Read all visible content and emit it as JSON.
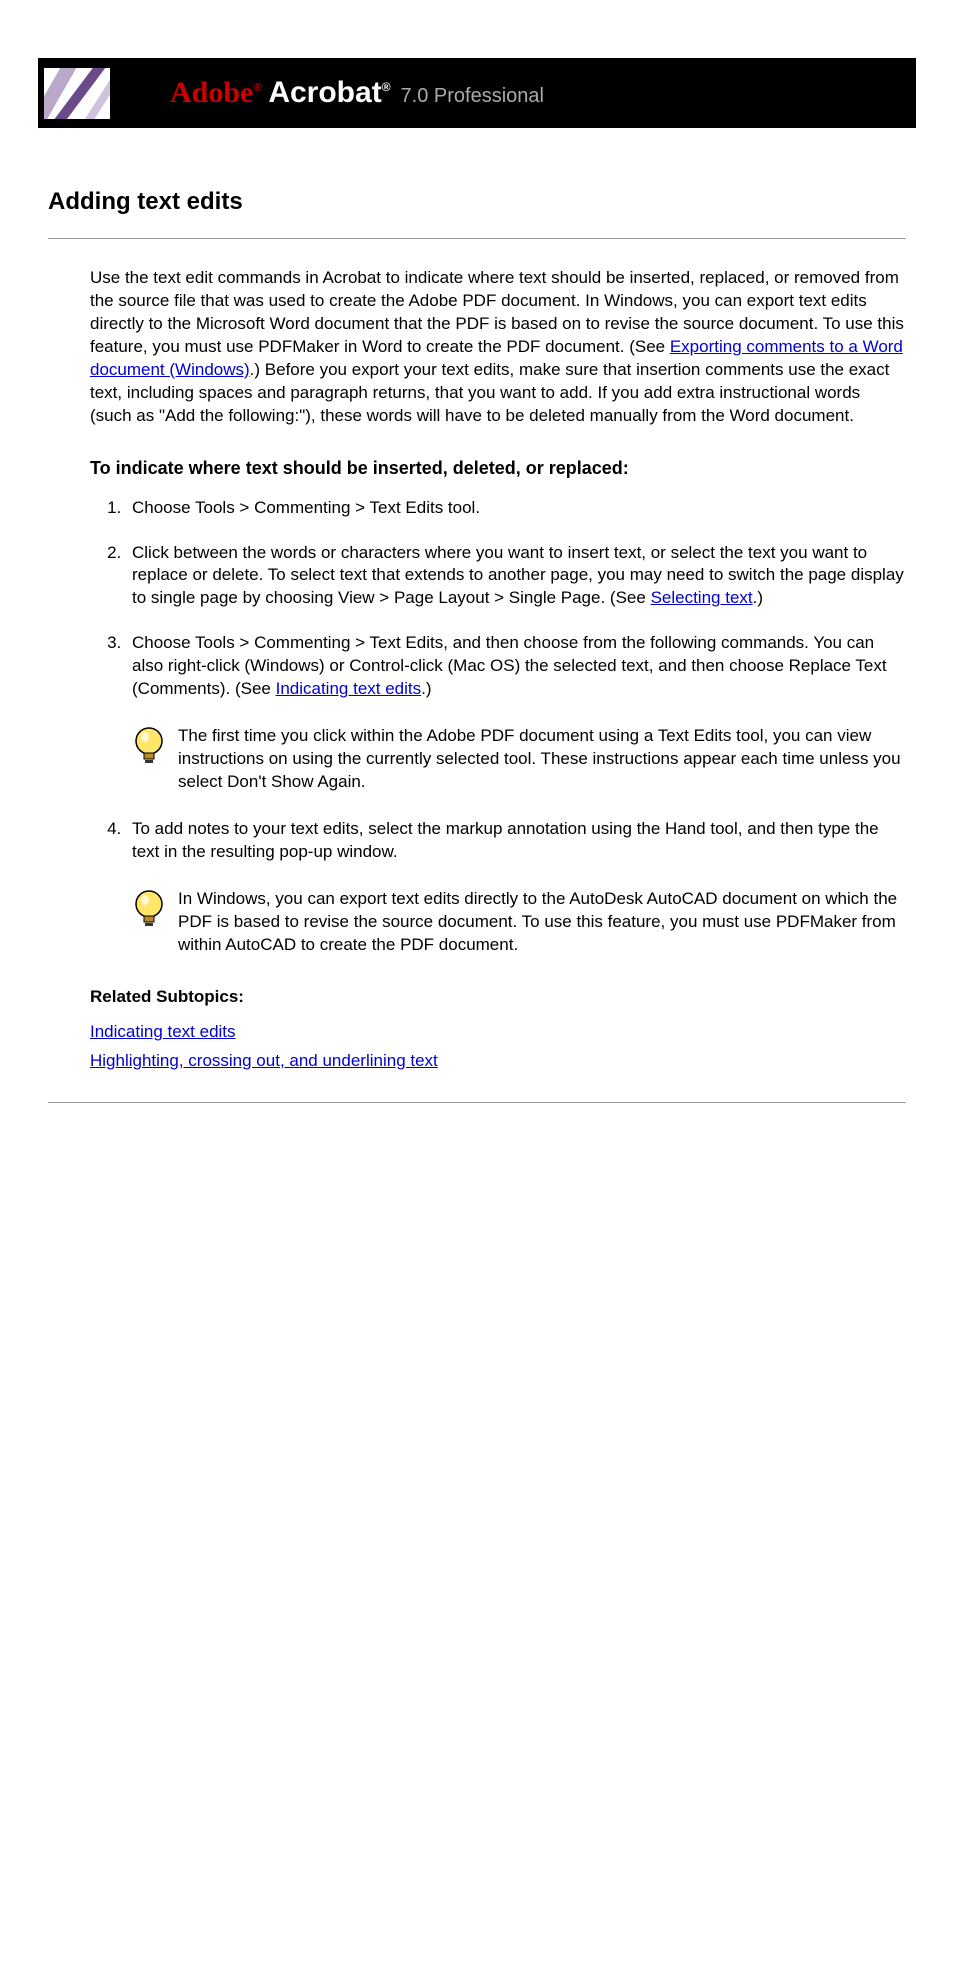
{
  "banner": {
    "adobe": "Adobe",
    "acrobat": "Acrobat",
    "version": "7.0 Professional",
    "reg1": "®",
    "reg2": "®"
  },
  "title": "Adding text edits",
  "intro_a": "Use the text edit commands in Acrobat to indicate where text should be inserted, replaced, or removed from the source file that was used to create the Adobe PDF document. In Windows, you can export text edits directly to the Microsoft Word document that the PDF is based on to revise the source document. To use this feature, you must use PDFMaker in Word to create the PDF document. (See ",
  "intro_link": "Exporting comments to a Word document (Windows)",
  "intro_b": ".) Before you export your text edits, make sure that insertion comments use the exact text, including spaces and paragraph returns, that you want to add. If you add extra instructional words (such as \"Add the following:\"), these words will have to be deleted manually from the Word document.",
  "subhead": "To indicate where text should be inserted, deleted, or replaced:",
  "steps": {
    "s1": "Choose Tools > Commenting > Text Edits tool.",
    "s2_a": "Click between the words or characters where you want to insert text, or select the text you want to replace or delete. To select text that extends to another page, you may need to switch the page display to single page by choosing View > Page Layout > Single Page. (See ",
    "s2_link": "Selecting text",
    "s2_b": ".)",
    "s3_a": "Choose Tools > Commenting > Text Edits, and then choose from the following commands. You can also right-click (Windows) or Control-click (Mac OS) the selected text, and then choose Replace Text (Comments). (See ",
    "s3_link": "Indicating text edits",
    "s3_b": ".)",
    "s4": "To add notes to your text edits, select the markup annotation using the Hand tool, and then type the text in the resulting pop-up window."
  },
  "tips": {
    "t1": "The first time you click within the Adobe PDF document using a Text Edits tool, you can view instructions on using the currently selected tool. These instructions appear each time unless you select Don't Show Again.",
    "t2": "In Windows, you can export text edits directly to the AutoDesk AutoCAD document on which the PDF is based to revise the source document. To use this feature, you must use PDFMaker from within AutoCAD to create the PDF document."
  },
  "related_head": "Related Subtopics:",
  "related": {
    "r1": "Indicating text edits",
    "r2": "Highlighting, crossing out, and underlining text"
  }
}
